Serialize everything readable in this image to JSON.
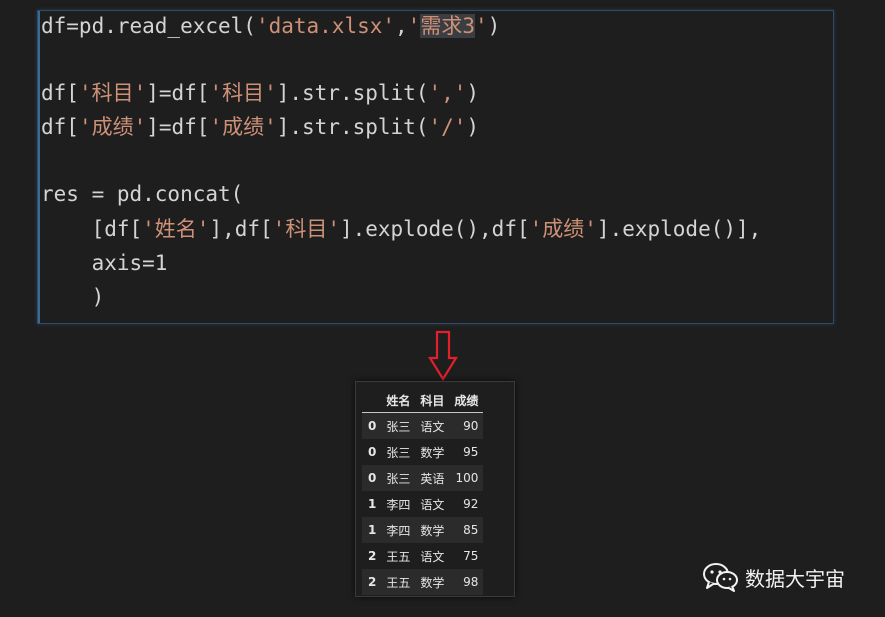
{
  "code": {
    "lines": [
      [
        "df=pd.read_excel(",
        "'data.xlsx'",
        ",",
        "'",
        "需求3",
        "'",
        ")"
      ],
      [],
      [
        "df[",
        "'科目'",
        "]=df[",
        "'科目'",
        "].str.split(",
        "','",
        ")"
      ],
      [
        "df[",
        "'成绩'",
        "]=df[",
        "'成绩'",
        "].str.split(",
        "'/'",
        ")"
      ],
      [],
      [
        "res = pd.concat("
      ],
      [
        "    [df[",
        "'姓名'",
        "],df[",
        "'科目'",
        "].explode(),df[",
        "'成绩'",
        "].explode()],"
      ],
      [
        "    axis=1"
      ],
      [
        "    )"
      ]
    ]
  },
  "table": {
    "headers": [
      "",
      "姓名",
      "科目",
      "成绩"
    ],
    "rows": [
      [
        "0",
        "张三",
        "语文",
        "90"
      ],
      [
        "0",
        "张三",
        "数学",
        "95"
      ],
      [
        "0",
        "张三",
        "英语",
        "100"
      ],
      [
        "1",
        "李四",
        "语文",
        "92"
      ],
      [
        "1",
        "李四",
        "数学",
        "85"
      ],
      [
        "2",
        "王五",
        "语文",
        "75"
      ],
      [
        "2",
        "王五",
        "数学",
        "98"
      ]
    ]
  },
  "watermark": {
    "text": "数据大宇宙",
    "icon": "wechat-icon"
  },
  "colors": {
    "background": "#1e1e1e",
    "code_text": "#d4d4d4",
    "string": "#ce9178",
    "arrow": "#e0202a"
  }
}
